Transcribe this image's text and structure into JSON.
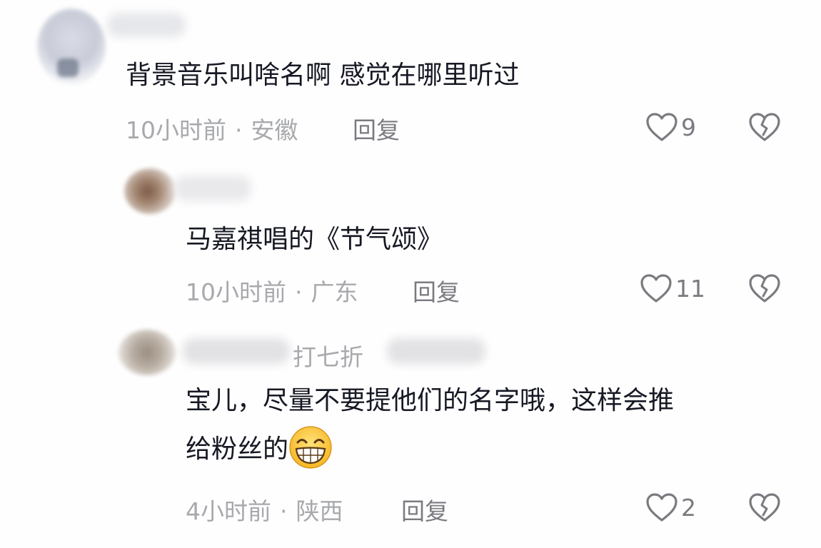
{
  "comments": [
    {
      "text": "背景音乐叫啥名啊 感觉在哪里听过",
      "time": "10小时前",
      "location": "安徽",
      "reply_label": "回复",
      "likes": "9"
    },
    {
      "text": "马嘉祺唱的《节气颂》",
      "time": "10小时前",
      "location": "广东",
      "reply_label": "回复",
      "likes": "11"
    },
    {
      "author_tag": "打七折",
      "text_line1": "宝儿，尽量不要提他们的名字哦，这样会推",
      "text_line2": "给粉丝的",
      "emoji": "grin-emoji",
      "time": "4小时前",
      "location": "陕西",
      "reply_label": "回复",
      "likes": "2"
    }
  ],
  "separator": "·",
  "icons": {
    "like": "heart-outline-icon",
    "dislike": "broken-heart-icon"
  }
}
